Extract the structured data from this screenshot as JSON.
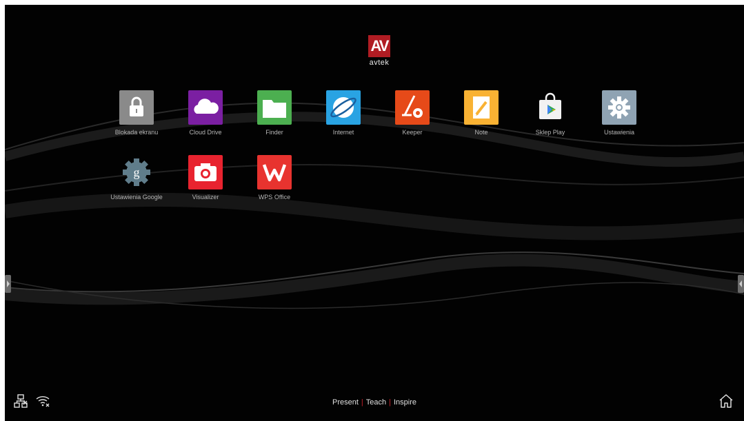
{
  "brand": {
    "logo_text": "AV",
    "name": "avtek",
    "accent": "#b01c23"
  },
  "apps": [
    {
      "label": "Blokada ekranu",
      "icon": "lock-icon",
      "color": "#8a8a8a"
    },
    {
      "label": "Cloud Drive",
      "icon": "cloud-icon",
      "color": "#7b1fa2"
    },
    {
      "label": "Finder",
      "icon": "folder-icon",
      "color": "#4caf50"
    },
    {
      "label": "Internet",
      "icon": "globe-icon",
      "color": "#29a3e3"
    },
    {
      "label": "Keeper",
      "icon": "vacuum-icon",
      "color": "#e64a19"
    },
    {
      "label": "Note",
      "icon": "note-icon",
      "color": "#f9b233"
    },
    {
      "label": "Sklep Play",
      "icon": "play-store-icon",
      "color": "#ffffff"
    },
    {
      "label": "Ustawienia",
      "icon": "gear-icon",
      "color": "#8fa3b3"
    },
    {
      "label": "Ustawienia Google",
      "icon": "google-settings-icon",
      "color": "#607d8b"
    },
    {
      "label": "Visualizer",
      "icon": "camera-icon",
      "color": "#e8232f"
    },
    {
      "label": "WPS Office",
      "icon": "wps-icon",
      "color": "#e8332f"
    }
  ],
  "footer": {
    "slogan_present": "Present",
    "slogan_teach": "Teach",
    "slogan_inspire": "Inspire",
    "separator": "|"
  },
  "status": {
    "network_icon": "ethernet-disconnected-icon",
    "wifi_icon": "wifi-off-icon",
    "home_icon": "home-icon"
  }
}
